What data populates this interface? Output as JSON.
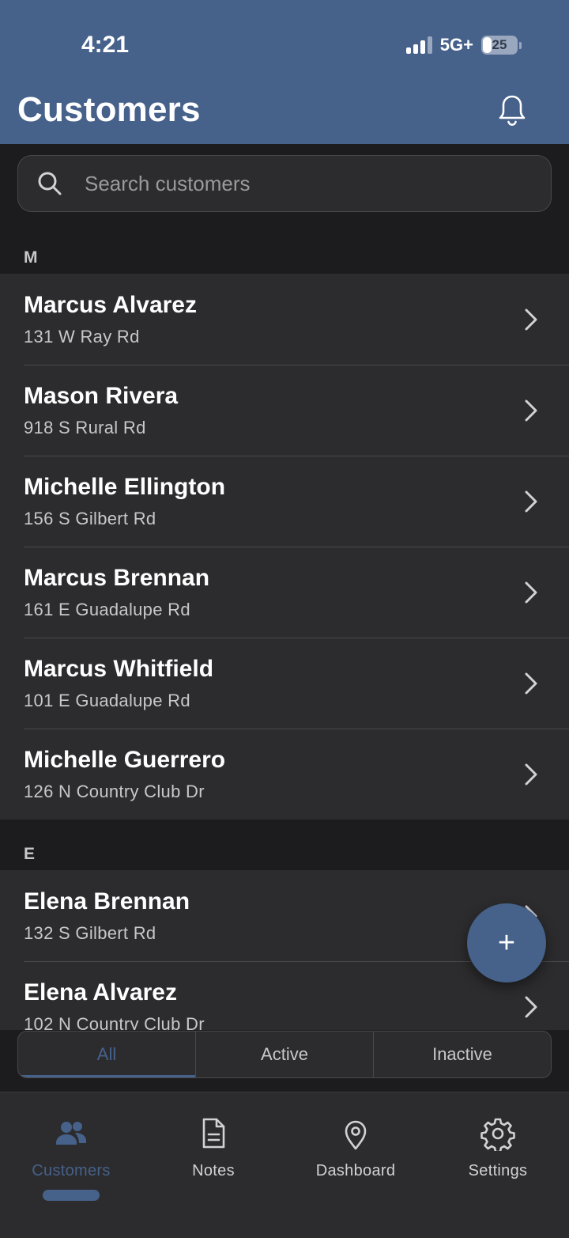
{
  "status": {
    "time": "4:21",
    "network": "5G+",
    "battery": "25",
    "battery_fraction": 0.25
  },
  "header": {
    "title": "Customers"
  },
  "search": {
    "placeholder": "Search customers"
  },
  "sections": [
    {
      "letter": "M",
      "customers": [
        {
          "name": "Marcus Alvarez",
          "address": "131 W Ray Rd"
        },
        {
          "name": "Mason Rivera",
          "address": "918 S Rural Rd"
        },
        {
          "name": "Michelle Ellington",
          "address": "156 S Gilbert Rd"
        },
        {
          "name": "Marcus Brennan",
          "address": "161 E Guadalupe Rd"
        },
        {
          "name": "Marcus Whitfield",
          "address": "101 E Guadalupe Rd"
        },
        {
          "name": "Michelle Guerrero",
          "address": "126 N Country Club Dr"
        }
      ]
    },
    {
      "letter": "E",
      "customers": [
        {
          "name": "Elena Brennan",
          "address": "132 S Gilbert Rd"
        },
        {
          "name": "Elena Alvarez",
          "address": "102 N Country Club Dr"
        }
      ]
    }
  ],
  "fab": {
    "label": "+"
  },
  "filter": {
    "options": [
      "All",
      "Active",
      "Inactive"
    ],
    "selected": "All"
  },
  "tabbar": {
    "items": [
      {
        "label": "Customers",
        "icon": "people-icon",
        "active": true
      },
      {
        "label": "Notes",
        "icon": "document-icon",
        "active": false
      },
      {
        "label": "Dashboard",
        "icon": "location-pin-icon",
        "active": false
      },
      {
        "label": "Settings",
        "icon": "gear-icon",
        "active": false
      }
    ]
  },
  "colors": {
    "accent": "#46618a",
    "background": "#1c1c1e",
    "row": "#2c2c2e"
  }
}
